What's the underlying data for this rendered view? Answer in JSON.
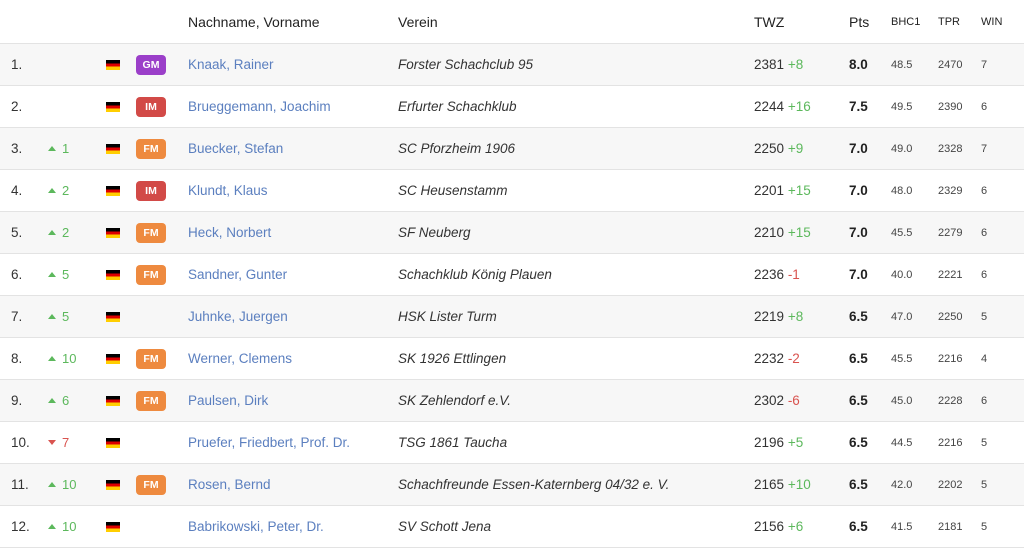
{
  "colors": {
    "GM": "#9b3fc9",
    "IM": "#d24a47",
    "FM": "#ee8a3f",
    "link": "#5b7fbf",
    "up": "#5cb85c",
    "down": "#d9534f"
  },
  "headers": {
    "name": "Nachname, Vorname",
    "club": "Verein",
    "twz": "TWZ",
    "pts": "Pts",
    "bhc1": "BHC1",
    "tpr": "TPR",
    "win": "WIN"
  },
  "rows": [
    {
      "rank": "1.",
      "change": "",
      "dir": "",
      "flag": "de-flag-icon",
      "title": "GM",
      "name": "Knaak, Rainer",
      "club": "Forster Schachclub 95",
      "twz": "2381",
      "twz_delta": "+8",
      "pts": "8.0",
      "bhc1": "48.5",
      "tpr": "2470",
      "win": "7"
    },
    {
      "rank": "2.",
      "change": "",
      "dir": "",
      "flag": "de-flag-icon",
      "title": "IM",
      "name": "Brueggemann, Joachim",
      "club": "Erfurter Schachklub",
      "twz": "2244",
      "twz_delta": "+16",
      "pts": "7.5",
      "bhc1": "49.5",
      "tpr": "2390",
      "win": "6"
    },
    {
      "rank": "3.",
      "change": "1",
      "dir": "up",
      "flag": "de-flag-icon",
      "title": "FM",
      "name": "Buecker, Stefan",
      "club": "SC Pforzheim 1906",
      "twz": "2250",
      "twz_delta": "+9",
      "pts": "7.0",
      "bhc1": "49.0",
      "tpr": "2328",
      "win": "7"
    },
    {
      "rank": "4.",
      "change": "2",
      "dir": "up",
      "flag": "de-flag-icon",
      "title": "IM",
      "name": "Klundt, Klaus",
      "club": "SC Heusenstamm",
      "twz": "2201",
      "twz_delta": "+15",
      "pts": "7.0",
      "bhc1": "48.0",
      "tpr": "2329",
      "win": "6"
    },
    {
      "rank": "5.",
      "change": "2",
      "dir": "up",
      "flag": "de-flag-icon",
      "title": "FM",
      "name": "Heck, Norbert",
      "club": "SF Neuberg",
      "twz": "2210",
      "twz_delta": "+15",
      "pts": "7.0",
      "bhc1": "45.5",
      "tpr": "2279",
      "win": "6"
    },
    {
      "rank": "6.",
      "change": "5",
      "dir": "up",
      "flag": "de-flag-icon",
      "title": "FM",
      "name": "Sandner, Gunter",
      "club": "Schachklub König Plauen",
      "twz": "2236",
      "twz_delta": "-1",
      "pts": "7.0",
      "bhc1": "40.0",
      "tpr": "2221",
      "win": "6"
    },
    {
      "rank": "7.",
      "change": "5",
      "dir": "up",
      "flag": "de-flag-icon",
      "title": "",
      "name": "Juhnke, Juergen",
      "club": "HSK Lister Turm",
      "twz": "2219",
      "twz_delta": "+8",
      "pts": "6.5",
      "bhc1": "47.0",
      "tpr": "2250",
      "win": "5"
    },
    {
      "rank": "8.",
      "change": "10",
      "dir": "up",
      "flag": "de-flag-icon",
      "title": "FM",
      "name": "Werner, Clemens",
      "club": "SK 1926 Ettlingen",
      "twz": "2232",
      "twz_delta": "-2",
      "pts": "6.5",
      "bhc1": "45.5",
      "tpr": "2216",
      "win": "4"
    },
    {
      "rank": "9.",
      "change": "6",
      "dir": "up",
      "flag": "de-flag-icon",
      "title": "FM",
      "name": "Paulsen, Dirk",
      "club": "SK Zehlendorf e.V.",
      "twz": "2302",
      "twz_delta": "-6",
      "pts": "6.5",
      "bhc1": "45.0",
      "tpr": "2228",
      "win": "6"
    },
    {
      "rank": "10.",
      "change": "7",
      "dir": "down",
      "flag": "de-flag-icon",
      "title": "",
      "name": "Pruefer, Friedbert, Prof. Dr.",
      "club": "TSG 1861 Taucha",
      "twz": "2196",
      "twz_delta": "+5",
      "pts": "6.5",
      "bhc1": "44.5",
      "tpr": "2216",
      "win": "5"
    },
    {
      "rank": "11.",
      "change": "10",
      "dir": "up",
      "flag": "de-flag-icon",
      "title": "FM",
      "name": "Rosen, Bernd",
      "club": "Schachfreunde Essen-Katernberg 04/32 e. V.",
      "twz": "2165",
      "twz_delta": "+10",
      "pts": "6.5",
      "bhc1": "42.0",
      "tpr": "2202",
      "win": "5"
    },
    {
      "rank": "12.",
      "change": "10",
      "dir": "up",
      "flag": "de-flag-icon",
      "title": "",
      "name": "Babrikowski, Peter, Dr.",
      "club": "SV Schott Jena",
      "twz": "2156",
      "twz_delta": "+6",
      "pts": "6.5",
      "bhc1": "41.5",
      "tpr": "2181",
      "win": "5"
    }
  ]
}
